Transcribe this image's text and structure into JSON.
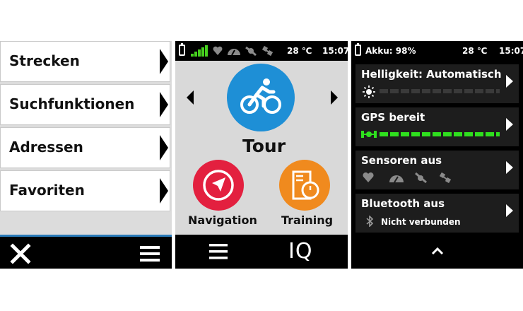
{
  "screen_list": {
    "items": [
      {
        "label": "Strecken"
      },
      {
        "label": "Suchfunktionen"
      },
      {
        "label": "Adressen"
      },
      {
        "label": "Favoriten"
      }
    ],
    "footer": {
      "close_icon": "close-icon",
      "menu_icon": "menu-icon"
    }
  },
  "screen_home": {
    "status": {
      "temperature": "28 ℃",
      "time": "15:07"
    },
    "main_app": {
      "label": "Tour",
      "icon": "bicycle-icon",
      "color": "#1e8fd6"
    },
    "apps": [
      {
        "label": "Navigation",
        "icon": "compass-arrow-icon",
        "color": "#e3203f"
      },
      {
        "label": "Training",
        "icon": "stopwatch-icon",
        "color": "#f08a1e"
      }
    ],
    "footer": {
      "menu_icon": "menu-icon",
      "iq_label": "IQ"
    }
  },
  "screen_status": {
    "status": {
      "battery": "Akku: 98%",
      "temperature": "28 ℃",
      "time": "15:07"
    },
    "cards": [
      {
        "title": "Helligkeit: Automatisch",
        "icon": "sun-icon",
        "level": 0
      },
      {
        "title": "GPS bereit",
        "icon": "satellite-icon",
        "level": 1
      },
      {
        "title": "Sensoren aus",
        "icons": [
          "heart-icon",
          "speedometer-icon",
          "cadence-icon",
          "power-icon"
        ]
      },
      {
        "title": "Bluetooth aus",
        "subtitle": "Nicht verbunden",
        "icon": "bluetooth-icon"
      }
    ],
    "colors": {
      "gps_green": "#2fe01e",
      "inactive": "#3a3a3a"
    }
  }
}
